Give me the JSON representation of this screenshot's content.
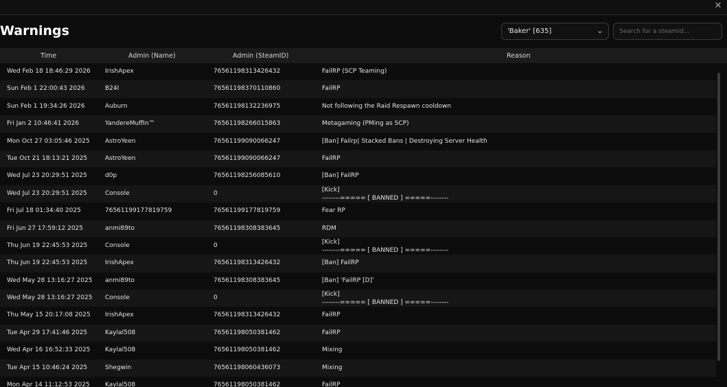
{
  "window": {
    "close_icon": "close-icon",
    "close_glyph": "✕"
  },
  "page": {
    "title": "Warnings"
  },
  "filter": {
    "selected": "'Baker' [635]",
    "chevron": "chevron-down-icon",
    "chevron_glyph": "⌄",
    "search_placeholder": "Search for a steamid..."
  },
  "table": {
    "headers": {
      "time": "Time",
      "admin_name": "Admin (Name)",
      "admin_steamid": "Admin (SteamID)",
      "reason": "Reason"
    },
    "rows": [
      {
        "time": "Wed Feb 18 18:46:29 2026",
        "admin": "IrishApex",
        "steamid": "76561198313426432",
        "reason": "FailRP (SCP Teaming)"
      },
      {
        "time": "Sun Feb 1 22:00:43 2026",
        "admin": "B24I",
        "steamid": "76561198370110860",
        "reason": "FailRP"
      },
      {
        "time": "Sun Feb 1 19:34:26 2026",
        "admin": "Auburn",
        "steamid": "76561198132236975",
        "reason": "Not following the Raid Respawn cooldown"
      },
      {
        "time": "Fri Jan 2 10:46:41 2026",
        "admin": "YandereMuffin™",
        "steamid": "76561198266015863",
        "reason": "Metagaming (PMing as SCP)"
      },
      {
        "time": "Mon Oct 27 03:05:46 2025",
        "admin": "AstroYeen",
        "steamid": "76561199090066247",
        "reason": "[Ban] Failrp| Stacked Bans | Destroying Server Health"
      },
      {
        "time": "Tue Oct 21 18:13:21 2025",
        "admin": "AstroYeen",
        "steamid": "76561199090066247",
        "reason": "FailRP"
      },
      {
        "time": "Wed Jul 23 20:29:51 2025",
        "admin": "d0p",
        "steamid": "76561198256085610",
        "reason": "[Ban] FailRP"
      },
      {
        "time": "Wed Jul 23 20:29:51 2025",
        "admin": "Console",
        "steamid": "0",
        "reason": "[Kick]",
        "reason2": "--------===== [ BANNED ] =====--------"
      },
      {
        "time": "Fri Jul 18 01:34:40 2025",
        "admin": "76561199177819759",
        "steamid": "76561199177819759",
        "reason": "Fear RP"
      },
      {
        "time": "Fri Jun 27 17:59:12 2025",
        "admin": "anmi89to",
        "steamid": "76561198308383645",
        "reason": "RDM"
      },
      {
        "time": "Thu Jun 19 22:45:53 2025",
        "admin": "Console",
        "steamid": "0",
        "reason": "[Kick]",
        "reason2": "--------===== [ BANNED ] =====--------"
      },
      {
        "time": "Thu Jun 19 22:45:53 2025",
        "admin": "IrishApex",
        "steamid": "76561198313426432",
        "reason": "[Ban] FailRP"
      },
      {
        "time": "Wed May 28 13:16:27 2025",
        "admin": "anmi89to",
        "steamid": "76561198308383645",
        "reason": "[Ban] 'FailRP [D]'"
      },
      {
        "time": "Wed May 28 13:16:27 2025",
        "admin": "Console",
        "steamid": "0",
        "reason": "[Kick]",
        "reason2": "--------===== [ BANNED ] =====--------"
      },
      {
        "time": "Thu May 15 20:17:08 2025",
        "admin": "IrishApex",
        "steamid": "76561198313426432",
        "reason": "FailRP"
      },
      {
        "time": "Tue Apr 29 17:41:46 2025",
        "admin": "Kaylal508",
        "steamid": "76561198050381462",
        "reason": "FailRP"
      },
      {
        "time": "Wed Apr 16 16:52:33 2025",
        "admin": "Kaylal508",
        "steamid": "76561198050381462",
        "reason": "Mixing"
      },
      {
        "time": "Tue Apr 15 10:46:24 2025",
        "admin": "Shegwin",
        "steamid": "76561198060436073",
        "reason": "Mixing"
      },
      {
        "time": "Mon Apr 14 11:12:53 2025",
        "admin": "Kaylal508",
        "steamid": "76561198050381462",
        "reason": "FailRP"
      }
    ]
  }
}
